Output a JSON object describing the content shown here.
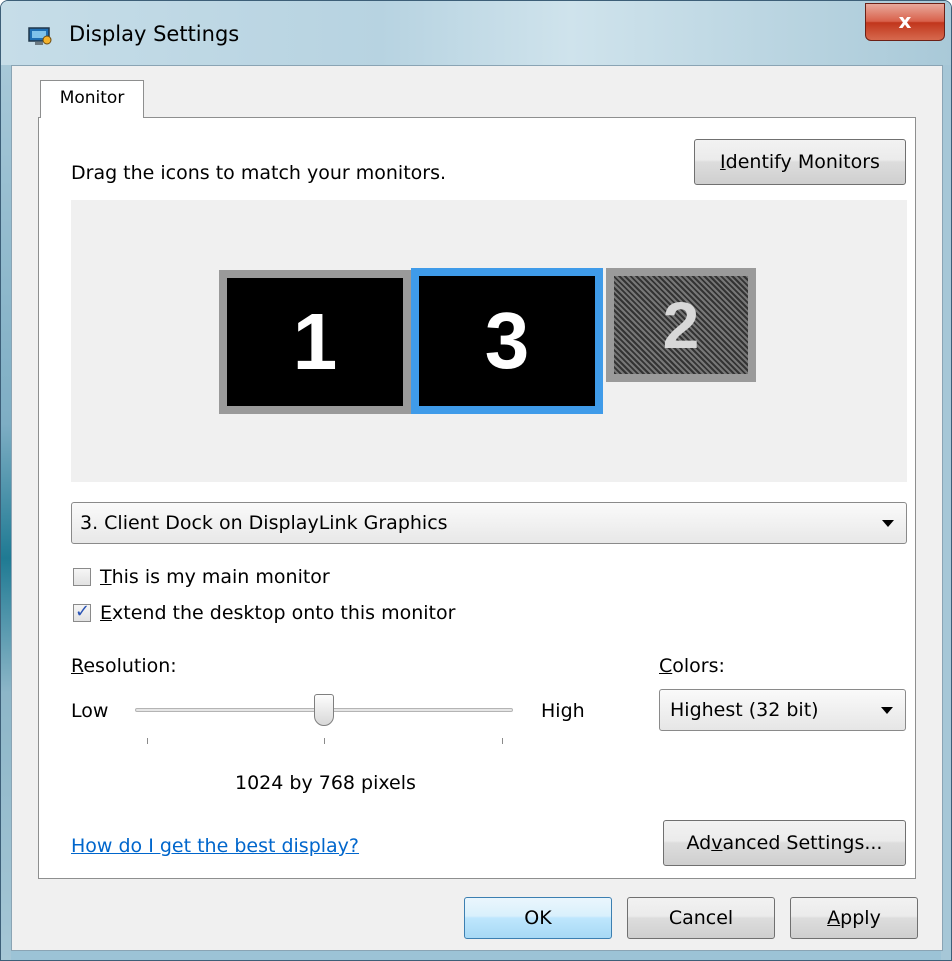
{
  "window": {
    "title": "Display Settings",
    "close_glyph": "x",
    "icon": "display-settings-icon"
  },
  "tabs": [
    {
      "label": "Monitor",
      "selected": true
    }
  ],
  "monitor_tab": {
    "instruction": "Drag the icons to match your monitors.",
    "identify_button": {
      "accel": "I",
      "rest": "dentify Monitors"
    },
    "monitors": [
      {
        "label": "1",
        "state": "active"
      },
      {
        "label": "3",
        "state": "selected"
      },
      {
        "label": "2",
        "state": "inactive"
      }
    ],
    "monitor_select": {
      "value": "3. Client Dock on DisplayLink Graphics"
    },
    "main_monitor_checkbox": {
      "accel": "T",
      "rest": "his is my main monitor",
      "checked": false
    },
    "extend_checkbox": {
      "accel": "E",
      "rest": "xtend the desktop onto this monitor",
      "checked": true
    },
    "resolution": {
      "label_accel": "R",
      "label_rest": "esolution:",
      "low_label": "Low",
      "high_label": "High",
      "value_text": "1024 by 768 pixels",
      "slider_position_fraction": 0.5
    },
    "colors": {
      "label_accel": "C",
      "label_rest": "olors:",
      "value": "Highest (32 bit)"
    },
    "help_link": "How do I get the best display?",
    "advanced_button": {
      "pre": "Ad",
      "accel": "v",
      "post": "anced Settings..."
    }
  },
  "footer": {
    "ok_label": "OK",
    "cancel_label": "Cancel",
    "apply_accel": "A",
    "apply_rest": "pply"
  },
  "colors": {
    "selected_monitor_border": "#3f9be9",
    "link": "#0066cc",
    "close_button": "#c1361c"
  }
}
